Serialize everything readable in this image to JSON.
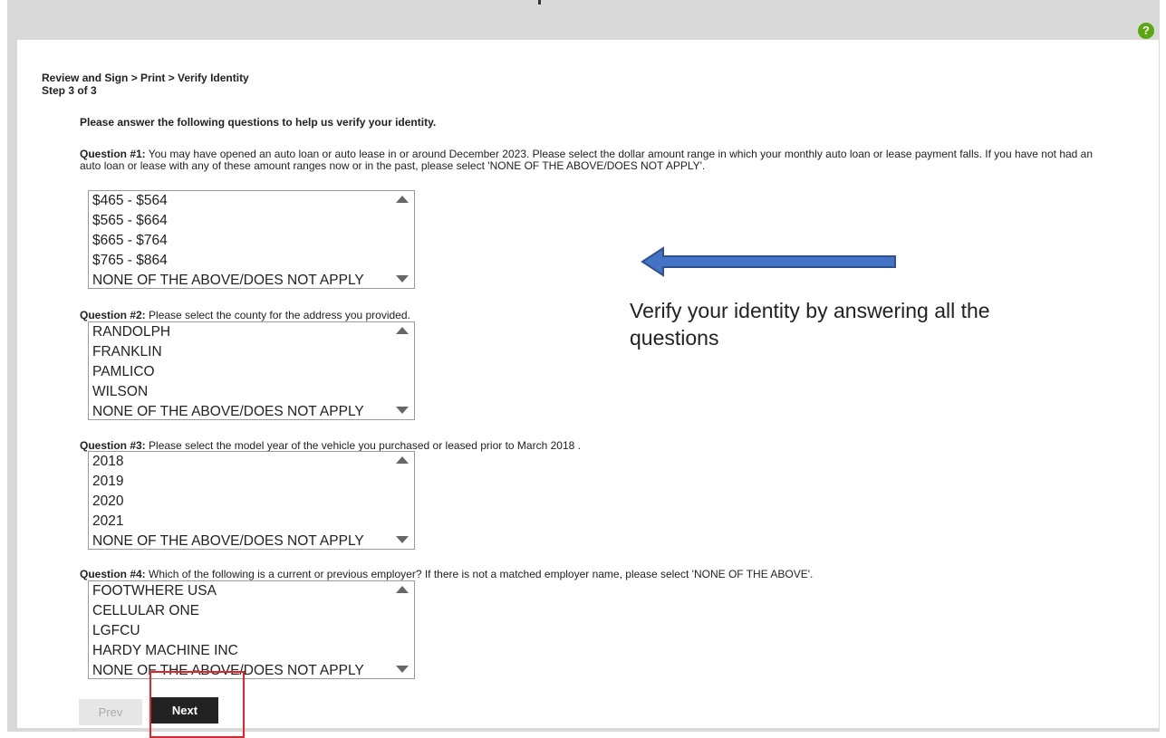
{
  "breadcrumb": "Review and Sign > Print > Verify Identity",
  "step": "Step 3 of 3",
  "intro": "Please answer the following questions to help us verify your identity.",
  "questions": [
    {
      "label": "Question #1:",
      "text": " You may have opened an auto loan or auto lease in or around December 2023. Please select the dollar amount range in which your monthly auto loan or lease payment falls. If you have not had an auto loan or lease with any of these amount ranges now or in the past, please select 'NONE OF THE ABOVE/DOES NOT APPLY'.",
      "options": [
        "$465 - $564",
        "$565 - $664",
        "$665 - $764",
        "$765 - $864",
        "NONE OF THE ABOVE/DOES NOT APPLY"
      ]
    },
    {
      "label": "Question #2:",
      "text": " Please select the county for the address you provided.",
      "options": [
        "RANDOLPH",
        "FRANKLIN",
        "PAMLICO",
        "WILSON",
        "NONE OF THE ABOVE/DOES NOT APPLY"
      ]
    },
    {
      "label": "Question #3:",
      "text": " Please select the model year of the vehicle you purchased or leased prior to March 2018 .",
      "options": [
        "2018",
        "2019",
        "2020",
        "2021",
        "NONE OF THE ABOVE/DOES NOT APPLY"
      ]
    },
    {
      "label": "Question #4:",
      "text": " Which of the following is a current or previous employer? If there is not a matched employer name, please select 'NONE OF THE ABOVE'.",
      "options": [
        "FOOTWHERE USA",
        "CELLULAR ONE",
        "LGFCU",
        "HARDY MACHINE INC",
        "NONE OF THE ABOVE/DOES NOT APPLY"
      ]
    }
  ],
  "buttons": {
    "prev": "Prev",
    "next": "Next"
  },
  "help_icon_glyph": "?",
  "annotation": "Verify your identity by answering all the questions",
  "colors": {
    "accent_next": "#222222",
    "help_green": "#5aa70f",
    "highlight_red": "#e3242b",
    "arrow_blue": "#4472c4"
  }
}
